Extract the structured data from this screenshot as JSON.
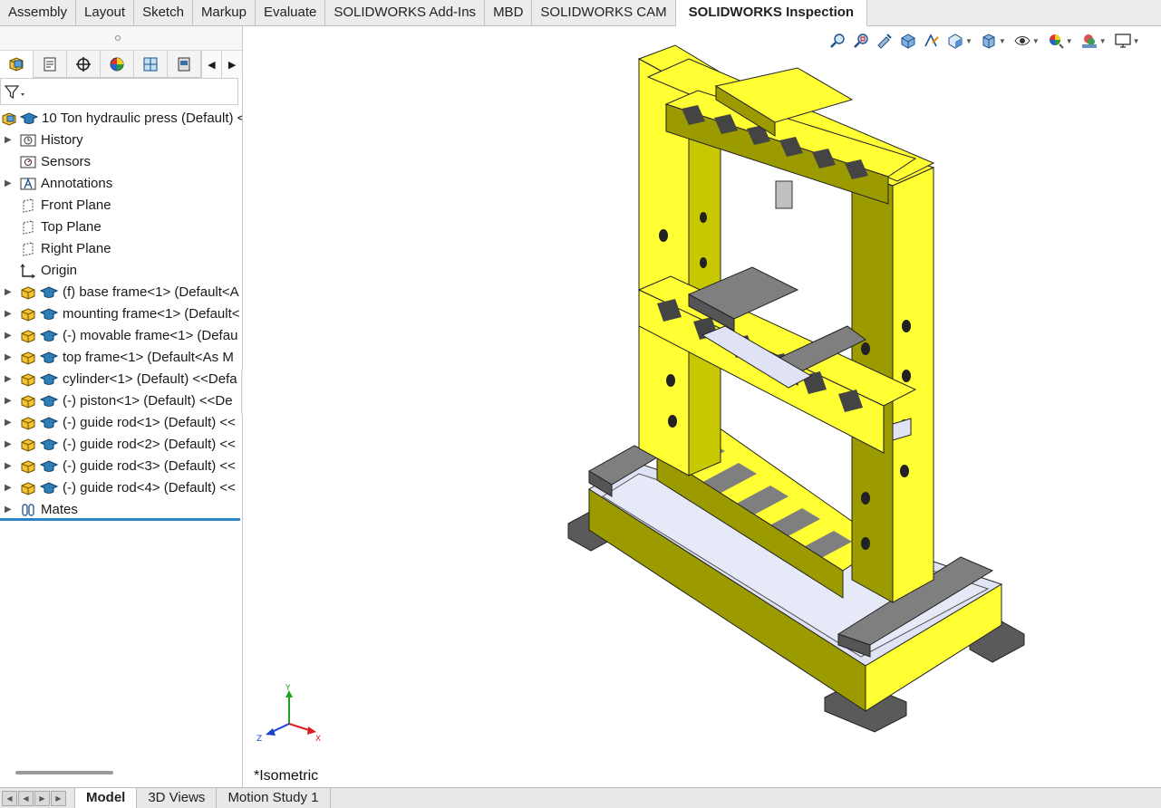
{
  "command_tabs": [
    {
      "label": "Assembly"
    },
    {
      "label": "Layout"
    },
    {
      "label": "Sketch"
    },
    {
      "label": "Markup"
    },
    {
      "label": "Evaluate"
    },
    {
      "label": "SOLIDWORKS Add-Ins"
    },
    {
      "label": "MBD"
    },
    {
      "label": "SOLIDWORKS CAM"
    },
    {
      "label": "SOLIDWORKS Inspection",
      "active": true
    }
  ],
  "manager_tabs": [
    {
      "icon": "featuremanager-icon"
    },
    {
      "icon": "propertymanager-icon"
    },
    {
      "icon": "configurationmanager-icon"
    },
    {
      "icon": "displaymanager-icon"
    },
    {
      "icon": "dimxpertmanager-icon"
    },
    {
      "icon": "cam-manager-icon"
    }
  ],
  "tree": {
    "root": {
      "label": "10 Ton hydraulic press  (Default) <"
    },
    "features": [
      {
        "label": "History",
        "icon": "history-icon",
        "expandable": true
      },
      {
        "label": "Sensors",
        "icon": "sensors-icon",
        "expandable": false
      },
      {
        "label": "Annotations",
        "icon": "annotations-icon",
        "expandable": true
      },
      {
        "label": "Front Plane",
        "icon": "plane-icon",
        "expandable": false
      },
      {
        "label": "Top Plane",
        "icon": "plane-icon",
        "expandable": false
      },
      {
        "label": "Right Plane",
        "icon": "plane-icon",
        "expandable": false
      },
      {
        "label": "Origin",
        "icon": "origin-icon",
        "expandable": false
      }
    ],
    "components": [
      {
        "label": "(f) base frame<1> (Default<A"
      },
      {
        "label": "mounting frame<1> (Default<"
      },
      {
        "label": "(-) movable frame<1> (Defau"
      },
      {
        "label": "top frame<1> (Default<As M"
      },
      {
        "label": "cylinder<1> (Default) <<Defa"
      },
      {
        "label": "(-) piston<1> (Default) <<De"
      },
      {
        "label": "(-) guide rod<1> (Default) <<"
      },
      {
        "label": "(-) guide rod<2> (Default) <<"
      },
      {
        "label": "(-) guide rod<3> (Default) <<"
      },
      {
        "label": "(-) guide rod<4> (Default) <<"
      }
    ],
    "mates": {
      "label": "Mates"
    }
  },
  "viewport": {
    "view_name": "*Isometric",
    "triad": {
      "x": "X",
      "y": "Y",
      "z": "Z"
    },
    "heads_up_icons": [
      "zoom-to-fit-icon",
      "zoom-to-area-icon",
      "previous-view-icon",
      "section-view-icon",
      "dynamic-annotation-icon",
      "view-orientation-icon",
      "display-style-icon",
      "hide-show-items-icon",
      "edit-appearance-icon",
      "apply-scene-icon",
      "view-settings-icon"
    ],
    "model_colors": {
      "frame": "#ffff33",
      "frame_shade": "#9b9b00",
      "frame_dark": "#7a7a00",
      "plate": "#7f7f7f",
      "base_plate": "#dfe3f5"
    }
  },
  "bottom_tabs": [
    {
      "label": "Model",
      "active": true
    },
    {
      "label": "3D Views"
    },
    {
      "label": "Motion Study 1"
    }
  ]
}
